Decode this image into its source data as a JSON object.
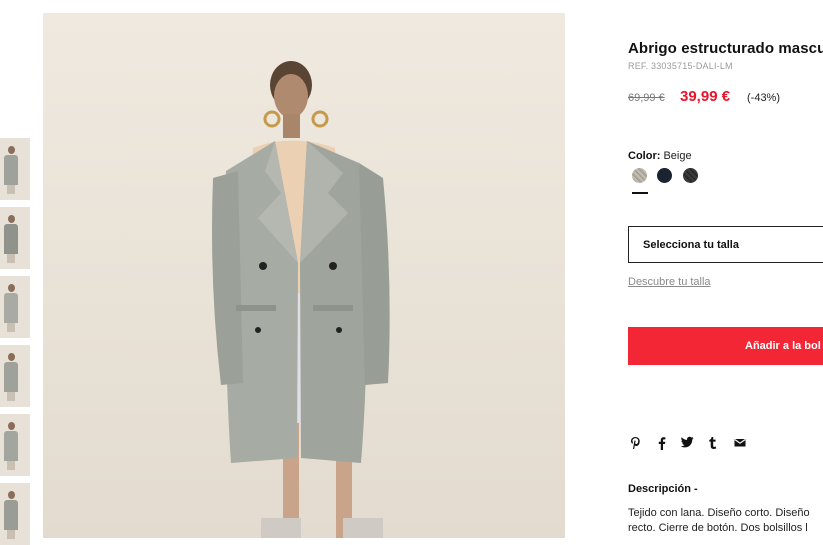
{
  "gallery": {
    "thumbnails": [
      "thumb-1",
      "thumb-2",
      "thumb-3",
      "thumb-4",
      "thumb-5",
      "thumb-6"
    ]
  },
  "product": {
    "title": "Abrigo estructurado mascu",
    "ref": "REF. 33035715-DALI-LM",
    "price_old": "69,99 €",
    "price_new": "39,99 €",
    "discount": "(-43%)"
  },
  "color": {
    "label": "Color:",
    "selected": "Beige",
    "swatches": [
      {
        "name": "beige",
        "hex": "#b9b2a6"
      },
      {
        "name": "navy",
        "hex": "#1b2230"
      },
      {
        "name": "charcoal",
        "hex": "#353535"
      }
    ]
  },
  "size": {
    "select_label": "Selecciona tu talla",
    "guide_link": "Descubre tu talla"
  },
  "actions": {
    "add_to_bag": "Añadir a la bol"
  },
  "share": {
    "icons": [
      "pinterest-icon",
      "facebook-icon",
      "twitter-icon",
      "tumblr-icon",
      "email-icon"
    ],
    "glyphs": [
      "P",
      "f",
      "🐦",
      "t",
      "✉"
    ]
  },
  "description": {
    "title": "Descripción -",
    "line1": "Tejido con lana. Diseño corto. Diseño",
    "line2": "recto. Cierre de botón. Dos bolsillos l"
  },
  "colors": {
    "accent": "#f32636",
    "price_red": "#e8152d"
  }
}
